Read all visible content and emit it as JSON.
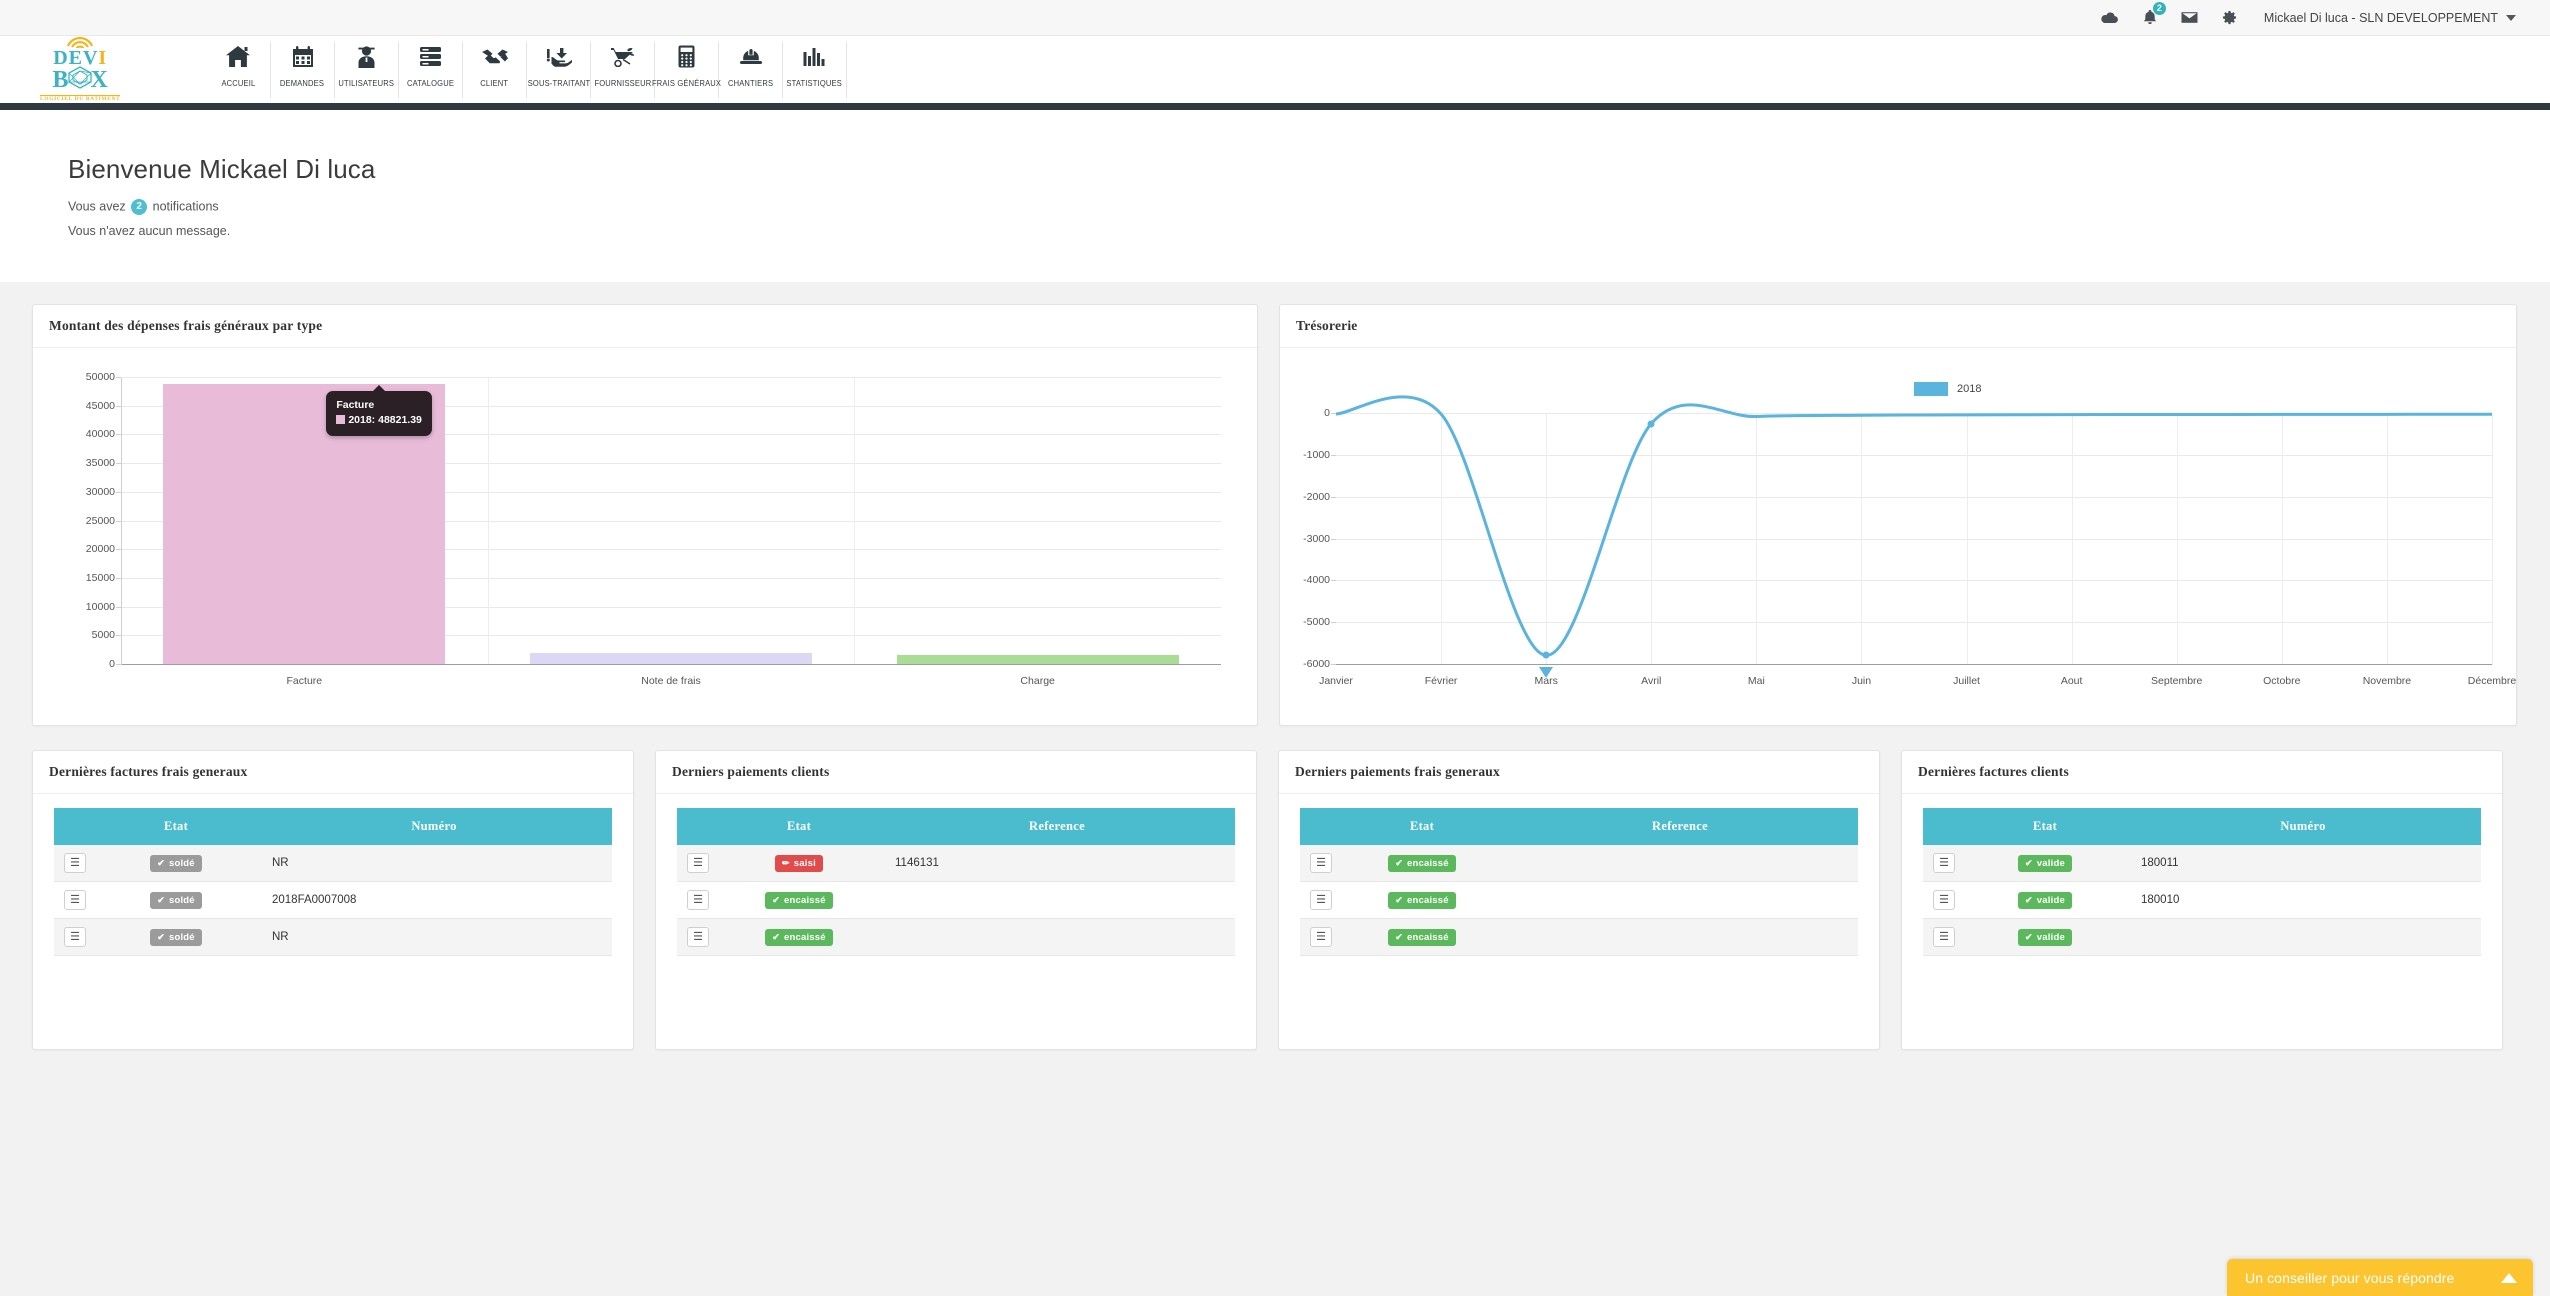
{
  "topbar": {
    "icons": [
      "cloud-icon",
      "bell-icon",
      "envelope-icon",
      "gear-icon"
    ],
    "notification_count": "2",
    "user_label": "Mickael Di luca - SLN DEVELOPPEMENT"
  },
  "brand": {
    "line1": "DEV",
    "line1_accent": "I",
    "b": "B",
    "x": "X",
    "tagline": "LOGICIEL DU BATIMENT"
  },
  "nav": {
    "items": [
      {
        "label": "ACCUEIL",
        "icon": "home-icon"
      },
      {
        "label": "DEMANDES",
        "icon": "calendar-icon"
      },
      {
        "label": "UTILISATEURS",
        "icon": "worker-icon"
      },
      {
        "label": "CATALOGUE",
        "icon": "server-icon"
      },
      {
        "label": "CLIENT",
        "icon": "handshake-icon"
      },
      {
        "label": "SOUS-TRAITANT",
        "icon": "hand-download-icon"
      },
      {
        "label": "FOURNISSEUR",
        "icon": "wheelbarrow-icon"
      },
      {
        "label": "FRAIS GÉNÉRAUX",
        "icon": "calculator-icon"
      },
      {
        "label": "CHANTIERS",
        "icon": "hardhat-icon"
      },
      {
        "label": "STATISTIQUES",
        "icon": "bar-chart-icon"
      }
    ]
  },
  "welcome": {
    "title": "Bienvenue Mickael Di luca",
    "notif_prefix": "Vous avez",
    "notif_count": "2",
    "notif_suffix": "notifications",
    "messages": "Vous n'avez aucun message."
  },
  "panels": {
    "bar_title": "Montant des dépenses frais généraux par type",
    "line_title": "Trésorerie"
  },
  "colors": {
    "accent_teal": "#4bbccd",
    "bar_facture": "#e8bcd8",
    "bar_note": "#dcd7f5",
    "bar_charge": "#a9dd96",
    "line_blue": "#5ab4dd",
    "chat_yellow": "#fcc530",
    "navbar_dark": "#2f3a40"
  },
  "chart_data": [
    {
      "type": "bar",
      "title": "Montant des dépenses frais généraux par type",
      "categories": [
        "Facture",
        "Note de frais",
        "Charge"
      ],
      "values": [
        48821.39,
        2000,
        1500
      ],
      "series": [
        {
          "name": "2018",
          "values": [
            48821.39,
            2000,
            1500
          ]
        }
      ],
      "bar_colors": [
        "#e8bcd8",
        "#dcd7f5",
        "#a9dd96"
      ],
      "yticks": [
        0,
        5000,
        10000,
        15000,
        20000,
        25000,
        30000,
        35000,
        40000,
        45000,
        50000
      ],
      "ylim": [
        0,
        50000
      ],
      "xlabel": "",
      "ylabel": "",
      "grid": true,
      "legend": false,
      "tooltip": {
        "title": "Facture",
        "series": "2018",
        "value": "48821.39",
        "text": "2018: 48821.39"
      }
    },
    {
      "type": "line",
      "title": "Trésorerie",
      "categories": [
        "Janvier",
        "Février",
        "Mars",
        "Avril",
        "Mai",
        "Juin",
        "Juillet",
        "Aout",
        "Septembre",
        "Octobre",
        "Novembre",
        "Décembre"
      ],
      "series": [
        {
          "name": "2018",
          "values": [
            0,
            0,
            -5770,
            -230,
            -60,
            -30,
            -20,
            -15,
            -12,
            -10,
            -8,
            -5
          ]
        }
      ],
      "yticks": [
        0,
        -1000,
        -2000,
        -3000,
        -4000,
        -5000,
        -6000
      ],
      "ylim": [
        -6000,
        0
      ],
      "xlabel": "",
      "ylabel": "",
      "grid": true,
      "legend": true,
      "legend_position": "top-right",
      "legend_entries": [
        "2018"
      ],
      "line_color": "#5ab4dd"
    }
  ],
  "tables": [
    {
      "title": "Dernières factures frais generaux",
      "columns": [
        "",
        "Etat",
        "Numéro"
      ],
      "rows": [
        {
          "menu": "☰",
          "state": "soldé",
          "state_type": "grey",
          "state_icon": "check",
          "value": "NR"
        },
        {
          "menu": "☰",
          "state": "soldé",
          "state_type": "grey",
          "state_icon": "check",
          "value": "2018FA0007008"
        },
        {
          "menu": "☰",
          "state": "soldé",
          "state_type": "grey",
          "state_icon": "check",
          "value": "NR"
        }
      ]
    },
    {
      "title": "Derniers paiements clients",
      "columns": [
        "",
        "Etat",
        "Reference"
      ],
      "rows": [
        {
          "menu": "☰",
          "state": "saisi",
          "state_type": "red",
          "state_icon": "pencil",
          "value": "1146131"
        },
        {
          "menu": "☰",
          "state": "encaissé",
          "state_type": "green",
          "state_icon": "check",
          "value": ""
        },
        {
          "menu": "☰",
          "state": "encaissé",
          "state_type": "green",
          "state_icon": "check",
          "value": ""
        }
      ]
    },
    {
      "title": "Derniers paiements frais generaux",
      "columns": [
        "",
        "Etat",
        "Reference"
      ],
      "rows": [
        {
          "menu": "☰",
          "state": "encaissé",
          "state_type": "green",
          "state_icon": "check",
          "value": ""
        },
        {
          "menu": "☰",
          "state": "encaissé",
          "state_type": "green",
          "state_icon": "check",
          "value": ""
        },
        {
          "menu": "☰",
          "state": "encaissé",
          "state_type": "green",
          "state_icon": "check",
          "value": ""
        }
      ]
    },
    {
      "title": "Dernières factures clients",
      "columns": [
        "",
        "Etat",
        "Numéro"
      ],
      "rows": [
        {
          "menu": "☰",
          "state": "valide",
          "state_type": "green",
          "state_icon": "check",
          "value": "180011"
        },
        {
          "menu": "☰",
          "state": "valide",
          "state_type": "green",
          "state_icon": "check",
          "value": "180010"
        },
        {
          "menu": "☰",
          "state": "valide",
          "state_type": "green",
          "state_icon": "check",
          "value": ""
        }
      ]
    }
  ],
  "chat": {
    "label": "Un conseiller pour vous répondre",
    "icon": "chevron-up-icon"
  }
}
